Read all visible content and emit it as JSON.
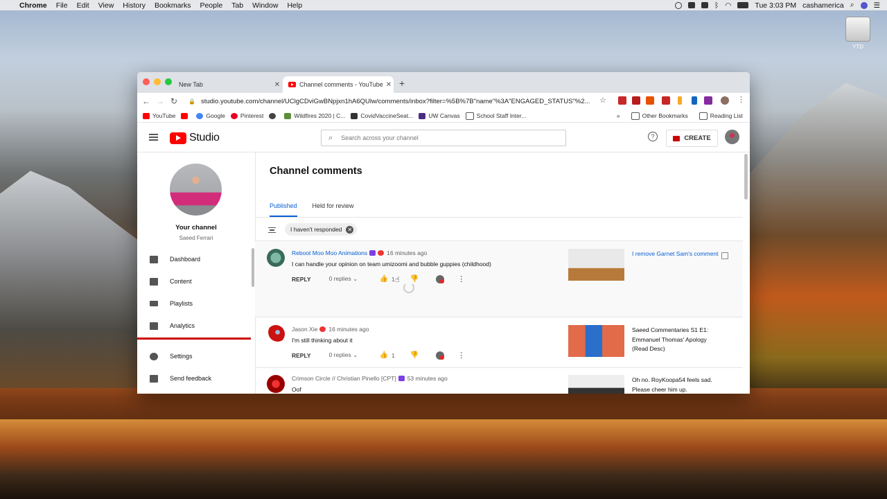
{
  "menubar": {
    "app": "Chrome",
    "items": [
      "File",
      "Edit",
      "View",
      "History",
      "Bookmarks",
      "People",
      "Tab",
      "Window",
      "Help"
    ],
    "clock": "Tue 3:03 PM",
    "user": "cashamerica"
  },
  "desktop": {
    "drive_label": "YTD"
  },
  "browser": {
    "tabs": [
      {
        "title": "New Tab"
      },
      {
        "title": "Channel comments - YouTube"
      }
    ],
    "url": "studio.youtube.com/channel/UClgCDviGwBNpjxn1hA6QUlw/comments/inbox?filter=%5B%7B\"name\"%3A\"ENGAGED_STATUS\"%2...",
    "bookmarks": [
      "YouTube",
      "Google",
      "Pinterest",
      "Wildfires 2020 | C...",
      "CovidVaccineSeat...",
      "UW Canvas",
      "School Staff Inter..."
    ],
    "bookmarks_right": [
      "Other Bookmarks",
      "Reading List"
    ]
  },
  "studio": {
    "logo_text": "Studio",
    "search_placeholder": "Search across your channel",
    "create_label": "CREATE",
    "help_glyph": "?",
    "channel": {
      "label": "Your channel",
      "name": "Saeed Ferrari"
    },
    "nav": [
      {
        "label": "Dashboard",
        "icon": "dashboard-icon"
      },
      {
        "label": "Content",
        "icon": "content-icon"
      },
      {
        "label": "Playlists",
        "icon": "playlists-icon"
      },
      {
        "label": "Analytics",
        "icon": "analytics-icon"
      },
      {
        "label": "Settings",
        "icon": "settings-icon"
      },
      {
        "label": "Send feedback",
        "icon": "feedback-icon"
      }
    ],
    "page_title": "Channel comments",
    "tabs": [
      {
        "label": "Published",
        "active": true
      },
      {
        "label": "Held for review",
        "active": false
      }
    ],
    "filter_chip": "I haven't responded",
    "comments": [
      {
        "author": "Reboot Moo Moo Animations",
        "time": "16 minutes ago",
        "text": "I can handle your opinion on team umizoomi and bubble guppies (childhood)",
        "reply_label": "REPLY",
        "replies": "0 replies",
        "likes": "1",
        "video_title": "I remove Garnet Sam's comment"
      },
      {
        "author": "Jason Xie",
        "time": "16 minutes ago",
        "text": "I'm still thinking about it",
        "reply_label": "REPLY",
        "replies": "0 replies",
        "likes": "1",
        "video_title": "Saeed Commentaries S1 E1: Emmanuel Thomas' Apology (Read Desc)"
      },
      {
        "author": "Crimson Circle // Christian Pinello [CPT]",
        "time": "53 minutes ago",
        "text": "Oof",
        "video_title": "Oh no. RoyKoopa54 feels sad. Please cheer him up."
      }
    ]
  },
  "colors": {
    "accent": "#065fd4",
    "brand_red": "#ff0000"
  }
}
